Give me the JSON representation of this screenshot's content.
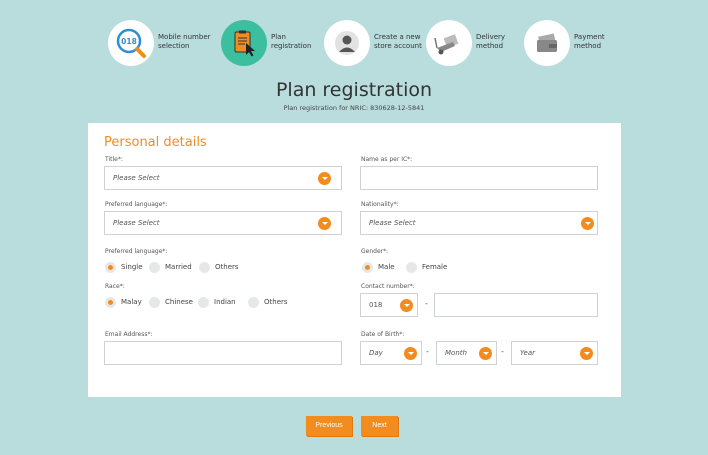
{
  "steps": [
    {
      "label": "Mobile number\nselection",
      "icon": "magnifier-icon",
      "badge": "018"
    },
    {
      "label": "Plan\nregistration",
      "icon": "clipboard-pointer-icon"
    },
    {
      "label": "Create a new\nstore account",
      "icon": "user-icon"
    },
    {
      "label": "Delivery\nmethod",
      "icon": "delivery-truck-icon"
    },
    {
      "label": "Payment\nmethod",
      "icon": "wallet-icon"
    }
  ],
  "page": {
    "title": "Plan registration",
    "subtitle": "Plan registration for NRIC: 830628-12-5841"
  },
  "form": {
    "section_title": "Personal details",
    "title_label": "Title*:",
    "title_value": "Please Select",
    "name_label": "Name as per IC*:",
    "name_value": "",
    "pref_lang_label": "Preferred language*:",
    "pref_lang_value": "Please Select",
    "nationality_label": "Nationality*:",
    "nationality_value": "Please Select",
    "marital_label": "Preferred language*:",
    "marital_options": [
      "Single",
      "Married",
      "Others"
    ],
    "marital_selected": "Single",
    "gender_label": "Gender*:",
    "gender_options": [
      "Male",
      "Female"
    ],
    "gender_selected": "Male",
    "race_label": "Race*:",
    "race_options": [
      "Malay",
      "Chinese",
      "Indian",
      "Others"
    ],
    "race_selected": "Malay",
    "contact_label": "Contact number*:",
    "contact_prefix": "018",
    "contact_value": "",
    "dash": "-",
    "email_label": "Email Address*:",
    "email_value": "",
    "dob_label": "Date of Birth*:",
    "dob_day": "Day",
    "dob_month": "Month",
    "dob_year": "Year"
  },
  "buttons": {
    "previous": "Previous",
    "next": "Next"
  },
  "colors": {
    "accent": "#f28c1e",
    "active_step": "#3bbf9f",
    "background": "#b9dcdd"
  }
}
